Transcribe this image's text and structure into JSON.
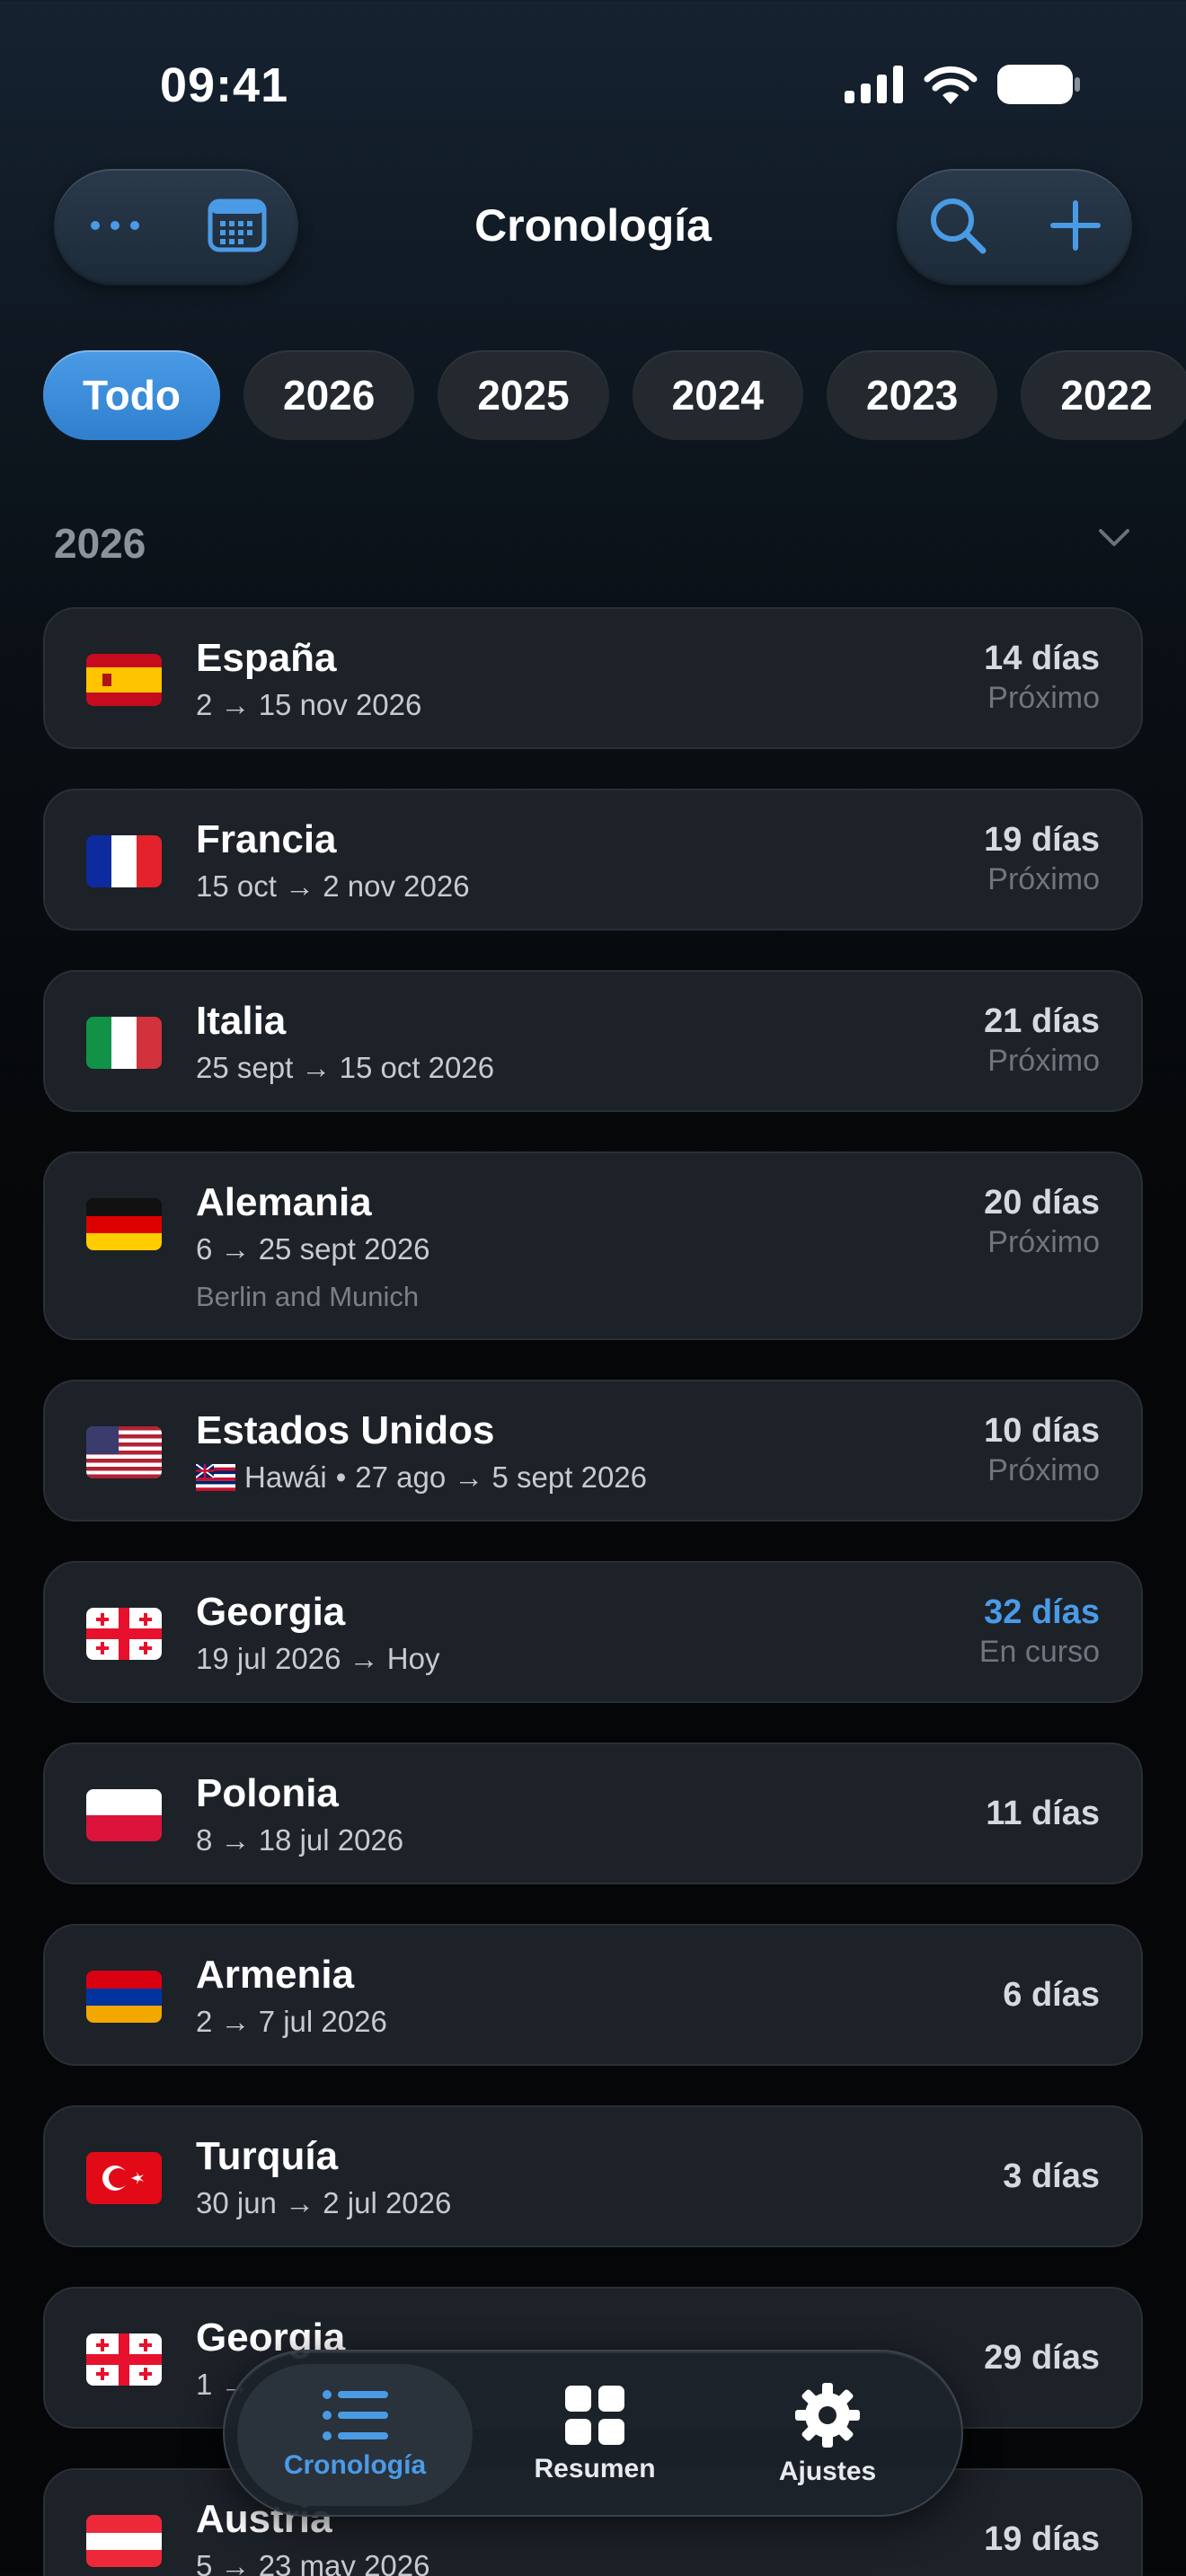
{
  "status_bar": {
    "time": "09:41"
  },
  "header": {
    "title": "Cronología",
    "left_icons": [
      "more-icon",
      "calendar-icon"
    ],
    "right_icons": [
      "search-icon",
      "plus-icon"
    ]
  },
  "year_filters": [
    "Todo",
    "2026",
    "2025",
    "2024",
    "2023",
    "2022"
  ],
  "selected_filter": "Todo",
  "section": {
    "year": "2026"
  },
  "trips": [
    {
      "flag": "es",
      "country": "España",
      "dates": "2 → 15 nov 2026",
      "duration": "14 días",
      "status": "Próximo"
    },
    {
      "flag": "fr",
      "country": "Francia",
      "dates": "15 oct → 2 nov 2026",
      "duration": "19 días",
      "status": "Próximo"
    },
    {
      "flag": "it",
      "country": "Italia",
      "dates": "25 sept → 15 oct 2026",
      "duration": "21 días",
      "status": "Próximo"
    },
    {
      "flag": "de",
      "country": "Alemania",
      "dates": "6 → 25 sept 2026",
      "note": "Berlin and Munich",
      "duration": "20 días",
      "status": "Próximo"
    },
    {
      "flag": "us",
      "country": "Estados Unidos",
      "sub_flag": "hi",
      "region": "Hawái",
      "dates": "27 ago → 5 sept 2026",
      "duration": "10 días",
      "status": "Próximo"
    },
    {
      "flag": "ge",
      "country": "Georgia",
      "dates": "19 jul 2026 → Hoy",
      "duration": "32 días",
      "status": "En curso"
    },
    {
      "flag": "pl",
      "country": "Polonia",
      "dates": "8 → 18 jul 2026",
      "duration": "11 días"
    },
    {
      "flag": "am",
      "country": "Armenia",
      "dates": "2 → 7 jul 2026",
      "duration": "6 días"
    },
    {
      "flag": "tr",
      "country": "Turquía",
      "dates": "30 jun → 2 jul 2026",
      "duration": "3 días"
    },
    {
      "flag": "ge",
      "country": "Georgia",
      "dates": "1 →",
      "duration": "29 días"
    },
    {
      "flag": "at",
      "country": "Austria",
      "dates": "5 → 23 may 2026",
      "duration": "19 días"
    }
  ],
  "tabbar": [
    {
      "label": "Cronología",
      "icon": "list-icon",
      "active": true
    },
    {
      "label": "Resumen",
      "icon": "grid-icon",
      "active": false
    },
    {
      "label": "Ajustes",
      "icon": "gear-icon",
      "active": false
    }
  ],
  "colors": {
    "accent": "#4a9be6",
    "card": "#1d2128",
    "background": "#050607"
  }
}
